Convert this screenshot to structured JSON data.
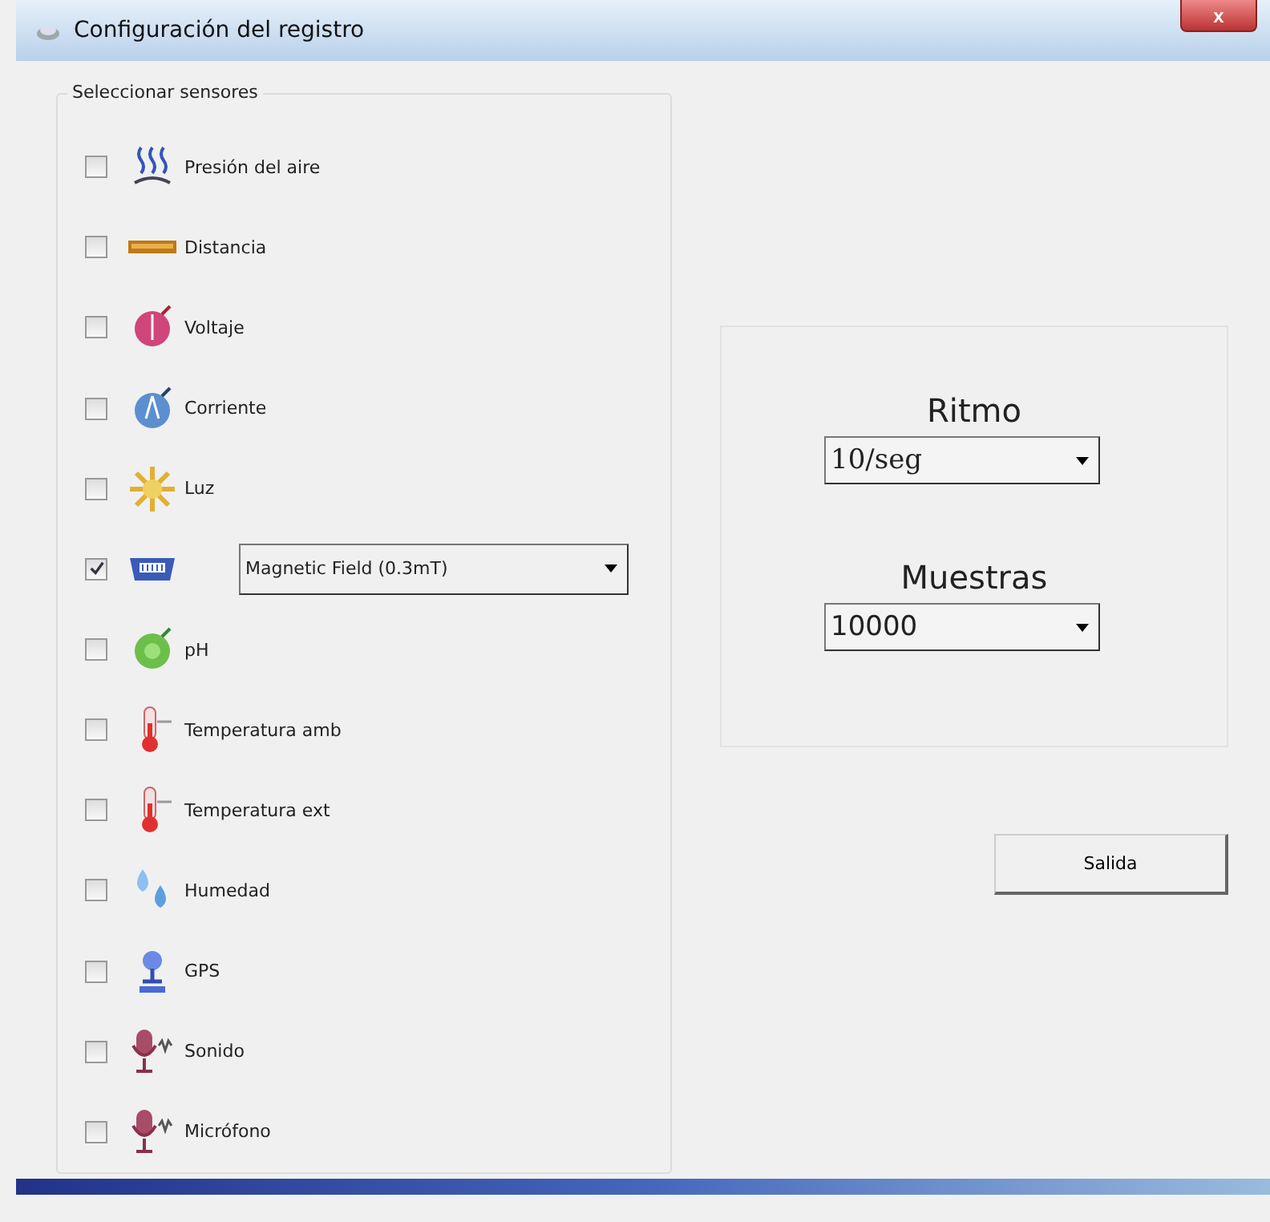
{
  "window": {
    "title": "Configuración del registro",
    "close": "x"
  },
  "sensors": {
    "title": "Seleccionar sensores",
    "items": [
      {
        "kind": "label",
        "label": "Presión del aire",
        "checked": false
      },
      {
        "kind": "label",
        "label": "Distancia",
        "checked": false
      },
      {
        "kind": "label",
        "label": "Voltaje",
        "checked": false
      },
      {
        "kind": "label",
        "label": "Corriente",
        "checked": false
      },
      {
        "kind": "label",
        "label": "Luz",
        "checked": false
      },
      {
        "kind": "dropdown",
        "value": "Magnetic Field (0.3mT)",
        "checked": true
      },
      {
        "kind": "label",
        "label": "pH",
        "checked": false
      },
      {
        "kind": "label",
        "label": "Temperatura amb",
        "checked": false
      },
      {
        "kind": "label",
        "label": "Temperatura ext",
        "checked": false
      },
      {
        "kind": "label",
        "label": "Humedad",
        "checked": false
      },
      {
        "kind": "label",
        "label": "GPS",
        "checked": false
      },
      {
        "kind": "label",
        "label": "Sonido",
        "checked": false
      },
      {
        "kind": "label",
        "label": "Micrófono",
        "checked": false
      }
    ]
  },
  "rate": {
    "label": "Ritmo",
    "value": "10/seg"
  },
  "samples": {
    "label": "Muestras",
    "value": "10000"
  },
  "exit_button": "Salida"
}
